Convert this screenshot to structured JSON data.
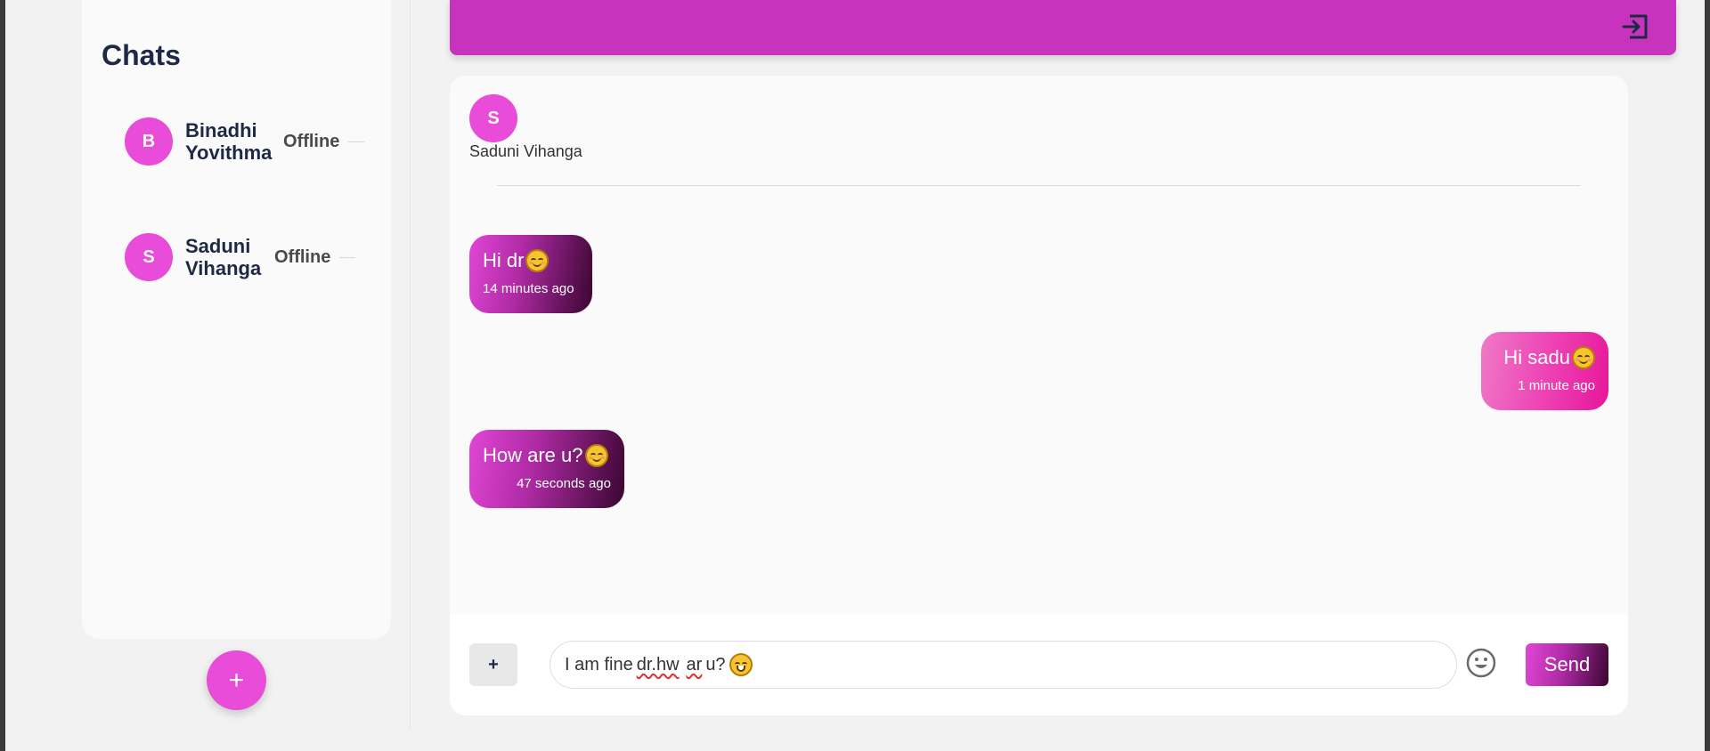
{
  "sidebar": {
    "title": "Chats",
    "items": [
      {
        "initial": "B",
        "name": "Binadhi Yovithma",
        "status": "Offline"
      },
      {
        "initial": "S",
        "name": "Saduni Vihanga",
        "status": "Offline"
      }
    ],
    "new_chat_label": "+"
  },
  "header": {
    "logout_icon": "logout-icon",
    "accent_color": "#c833bd"
  },
  "conversation": {
    "contact_initial": "S",
    "contact_name": "Saduni Vihanga",
    "messages": [
      {
        "direction": "incoming",
        "text": "Hi dr",
        "emoji": "smiling-face",
        "time": "14 minutes ago"
      },
      {
        "direction": "outgoing",
        "text": "Hi sadu ",
        "emoji": "smiling-face",
        "time": "1 minute ago"
      },
      {
        "direction": "incoming",
        "text": "How are u?",
        "emoji": "smiling-face",
        "time": "47 seconds ago"
      }
    ]
  },
  "composer": {
    "attach_label": "+",
    "input_value_parts": [
      "I am fine ",
      "dr.hw",
      " ",
      "ar",
      " u?"
    ],
    "input_emoji": "grinning-face",
    "emoji_icon": "emoji-picker-icon",
    "send_label": "Send"
  }
}
